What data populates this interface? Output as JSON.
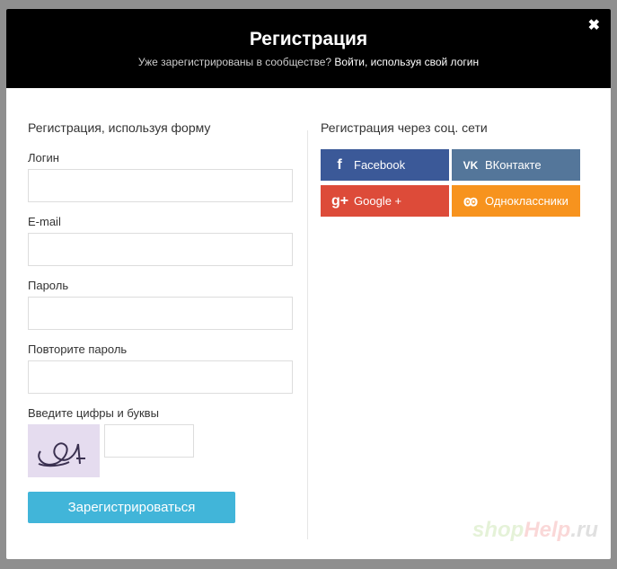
{
  "header": {
    "title": "Регистрация",
    "subtitle": "Уже зарегистрированы в сообществе?",
    "login_link": "Войти, используя свой логин",
    "close_icon": "close-icon"
  },
  "form": {
    "heading": "Регистрация, используя форму",
    "fields": [
      {
        "label": "Логин",
        "value": ""
      },
      {
        "label": "E-mail",
        "value": ""
      },
      {
        "label": "Пароль",
        "value": ""
      },
      {
        "label": "Повторите пароль",
        "value": ""
      }
    ],
    "captcha_label": "Введите цифры и буквы",
    "captcha_value": "",
    "submit": "Зарегистрироваться"
  },
  "social": {
    "heading": "Регистрация через соц. сети",
    "buttons": [
      {
        "label": "Facebook",
        "icon": "f",
        "color": "#3b5998"
      },
      {
        "label": "ВКонтакте",
        "icon": "vk",
        "color": "#54769a"
      },
      {
        "label": "Google +",
        "icon": "g+",
        "color": "#dd4b39"
      },
      {
        "label": "Одноклассники",
        "icon": "ok",
        "color": "#f7931e"
      }
    ]
  },
  "watermark": {
    "a": "shop",
    "b": "Help",
    ".c": ".ru",
    "c": ".ru"
  }
}
